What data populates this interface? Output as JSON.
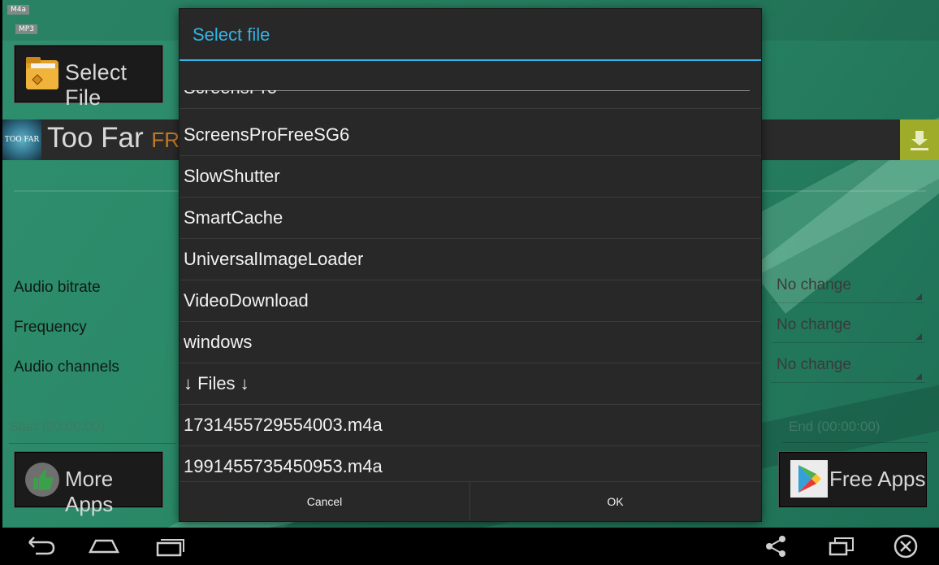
{
  "app": {
    "format_badge_top": "M4a",
    "format_badge_bottom": "MP3",
    "select_file_label": "Select File",
    "track_title": "Too Far",
    "track_title_suffix": "FR",
    "thumb_text": "TOO FAR",
    "settings": [
      {
        "label": "Audio bitrate",
        "value": "No change"
      },
      {
        "label": "Frequency",
        "value": "No change"
      },
      {
        "label": "Audio channels",
        "value": "No change"
      }
    ],
    "start_placeholder": "Start (00:00:00)",
    "end_placeholder": "End (00:00:00)",
    "more_apps_label": "More Apps",
    "free_apps_label": "Free Apps",
    "colors": {
      "background": "#2a8867",
      "download_button": "#9fac2a",
      "dialog_accent": "#33b5e5"
    }
  },
  "dialog": {
    "title": "Select file",
    "search_value": "",
    "items": [
      "ScreensPro",
      "ScreensProFreeSG6",
      "SlowShutter",
      "SmartCache",
      "UniversalImageLoader",
      "VideoDownload",
      "windows",
      "↓ Files ↓",
      "1731455729554003.m4a",
      "1991455735450953.m4a"
    ],
    "cancel_label": "Cancel",
    "ok_label": "OK"
  },
  "navbar": {
    "icons": [
      "back-icon",
      "home-icon",
      "recent-apps-icon",
      "share-icon",
      "screen-icon",
      "close-icon"
    ]
  }
}
